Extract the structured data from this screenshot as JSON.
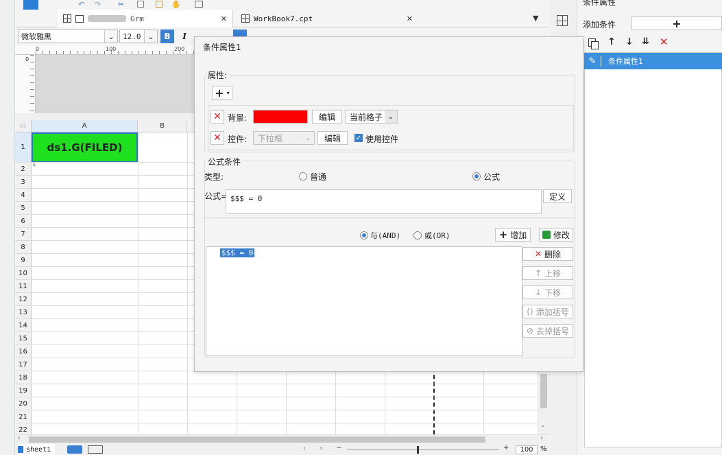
{
  "doc_tabs": [
    {
      "label": "Grm"
    },
    {
      "label": "WorkBook7.cpt"
    }
  ],
  "format_bar": {
    "font_name": "微软雅黑",
    "font_size": "12.0",
    "bold": "B",
    "italic": "I"
  },
  "ruler": {
    "zero": "0",
    "mark_100": "100",
    "mark_200": "200",
    "v_zero": "0"
  },
  "sheet": {
    "columns": [
      "A",
      "B"
    ],
    "rows": [
      "1",
      "2",
      "3",
      "4",
      "5",
      "6",
      "7",
      "8",
      "9",
      "10",
      "11",
      "12",
      "13",
      "14",
      "15",
      "16",
      "17",
      "18",
      "19",
      "20",
      "21",
      "22"
    ],
    "cell_a1": "ds1.G(FILED)",
    "tab_name": "sheet1",
    "zoom": "100",
    "zoom_unit": "%"
  },
  "dialog": {
    "title": "条件属性1",
    "props_label": "属性:",
    "add_btn": "+",
    "bg_label": "背景:",
    "bg_color": "#ff0000",
    "edit_label": "编辑",
    "bg_scope": "当前格子",
    "widget_label": "控件:",
    "widget_value": "下拉框",
    "edit_label2": "编辑",
    "use_widget_label": "使用控件",
    "formula_group_label": "公式条件",
    "type_label": "类型:",
    "type_normal": "普通",
    "type_formula": "公式",
    "formula_label": "公式=",
    "formula_value": "$$$ = 0",
    "define_btn": "定义",
    "and_label": "与(AND)",
    "or_label": "或(OR)",
    "add_cond_btn": "增加",
    "modify_btn": "修改",
    "delete_btn": "删除",
    "move_up_btn": "上移",
    "move_down_btn": "下移",
    "add_paren_btn": "添加括号",
    "remove_paren_btn": "去掉括号",
    "condition_list": [
      "$$$ = 0"
    ]
  },
  "right_panel": {
    "header": "条件属性",
    "add_condition_label": "添加条件",
    "add_condition_btn": "+",
    "items": [
      "条件属性1"
    ]
  },
  "colors": {
    "accent": "#3d8fe0",
    "cell_fill": "#1fe01f",
    "delete_red": "#e02020"
  }
}
